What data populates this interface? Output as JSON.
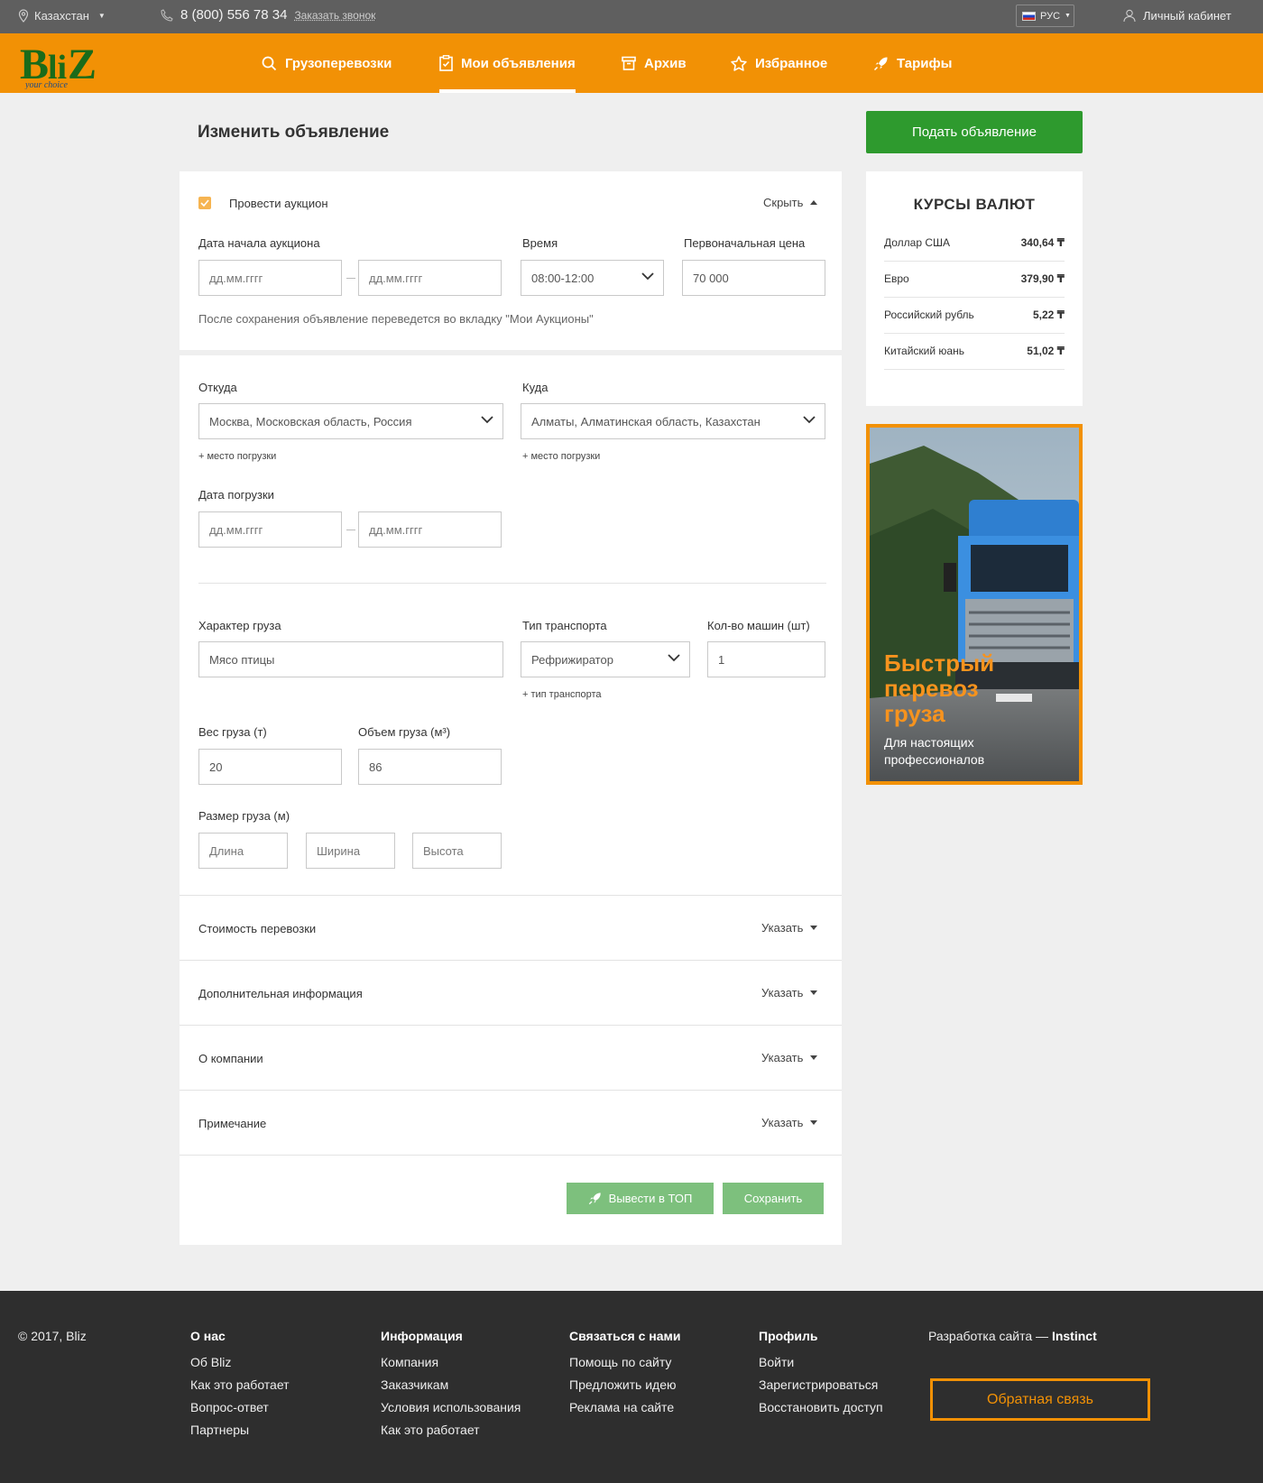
{
  "topbar": {
    "region": "Казахстан",
    "phone": "8 (800) 556 78 34",
    "callback": "Заказать звонок",
    "lang": "РУС",
    "account": "Личный кабинет"
  },
  "logo": {
    "text": "Bliz",
    "tagline": "your choice"
  },
  "nav": {
    "items": [
      {
        "label": "Грузоперевозки",
        "icon": "search-icon"
      },
      {
        "label": "Мои объявления",
        "icon": "clipboard-icon",
        "active": true
      },
      {
        "label": "Архив",
        "icon": "archive-icon"
      },
      {
        "label": "Избранное",
        "icon": "star-icon"
      },
      {
        "label": "Тарифы",
        "icon": "rocket-icon"
      }
    ]
  },
  "page": {
    "title": "Изменить объявление",
    "post_button": "Подать объявление"
  },
  "auction": {
    "checkbox_label": "Провести аукцион",
    "toggle": "Скрыть",
    "start_date_label": "Дата начала аукциона",
    "date_placeholder": "дд.мм.гггг",
    "time_label": "Время",
    "time_value": "08:00-12:00",
    "price_label": "Первоначальная цена",
    "price_value": "70 000",
    "note": "После сохранения объявление переведется во вкладку \"Мои Аукционы\""
  },
  "route": {
    "from_label": "Откуда",
    "from_value": "Москва, Московская область, Россия",
    "to_label": "Куда",
    "to_value": "Алматы, Алматинская область, Казахстан",
    "add_loading_place": "+ место погрузки",
    "loading_date_label": "Дата погрузки",
    "date_placeholder": "дд.мм.гггг"
  },
  "cargo": {
    "type_label": "Характер груза",
    "type_value": "Мясо птицы",
    "transport_label": "Тип транспорта",
    "transport_value": "Рефрижиратор",
    "add_transport": "+ тип транспорта",
    "cars_label": "Кол-во машин (шт)",
    "cars_value": "1",
    "weight_label": "Вес груза (т)",
    "weight_value": "20",
    "volume_label": "Объем груза (м³)",
    "volume_value": "86",
    "size_label": "Размер груза (м)",
    "length_placeholder": "Длина",
    "width_placeholder": "Ширина",
    "height_placeholder": "Высота"
  },
  "sections": [
    {
      "title": "Стоимость перевозки",
      "action": "Указать"
    },
    {
      "title": "Дополнительная информация",
      "action": "Указать"
    },
    {
      "title": "О компании",
      "action": "Указать"
    },
    {
      "title": "Примечание",
      "action": "Указать"
    }
  ],
  "actions": {
    "top_button": "Вывести в ТОП",
    "save_button": "Сохранить"
  },
  "rates": {
    "title": "КУРСЫ ВАЛЮТ",
    "items": [
      {
        "name": "Доллар США",
        "value": "340,64 ₸"
      },
      {
        "name": "Евро",
        "value": "379,90 ₸"
      },
      {
        "name": "Российский рубль",
        "value": "5,22 ₸"
      },
      {
        "name": "Китайский юань",
        "value": "51,02 ₸"
      }
    ]
  },
  "ad": {
    "line1": "Быстрый",
    "line2": "перевоз",
    "line3": "груза",
    "sub1": "Для настоящих",
    "sub2": "профессионалов"
  },
  "footer": {
    "copyright": "© 2017, Bliz",
    "columns": [
      {
        "title": "О нас",
        "links": [
          "Об Bliz",
          "Как это работает",
          "Вопрос-ответ",
          "Партнеры"
        ]
      },
      {
        "title": "Информация",
        "links": [
          "Компания",
          "Заказчикам",
          "Условия использования",
          "Как это работает"
        ]
      },
      {
        "title": "Связаться с нами",
        "links": [
          "Помощь по сайту",
          "Предложить идею",
          "Реклама на сайте"
        ]
      },
      {
        "title": "Профиль",
        "links": [
          "Войти",
          "Зарегистрироваться",
          "Восстановить доступ"
        ]
      }
    ],
    "dev_prefix": "Разработка сайта —",
    "dev_name": "Instinct",
    "feedback_button": "Обратная связь"
  },
  "colors": {
    "accent": "#f29105",
    "green": "#2e9a2e",
    "green_light": "#7dc07d",
    "footer": "#2e2e2e",
    "topbar": "#5f5f5f"
  }
}
